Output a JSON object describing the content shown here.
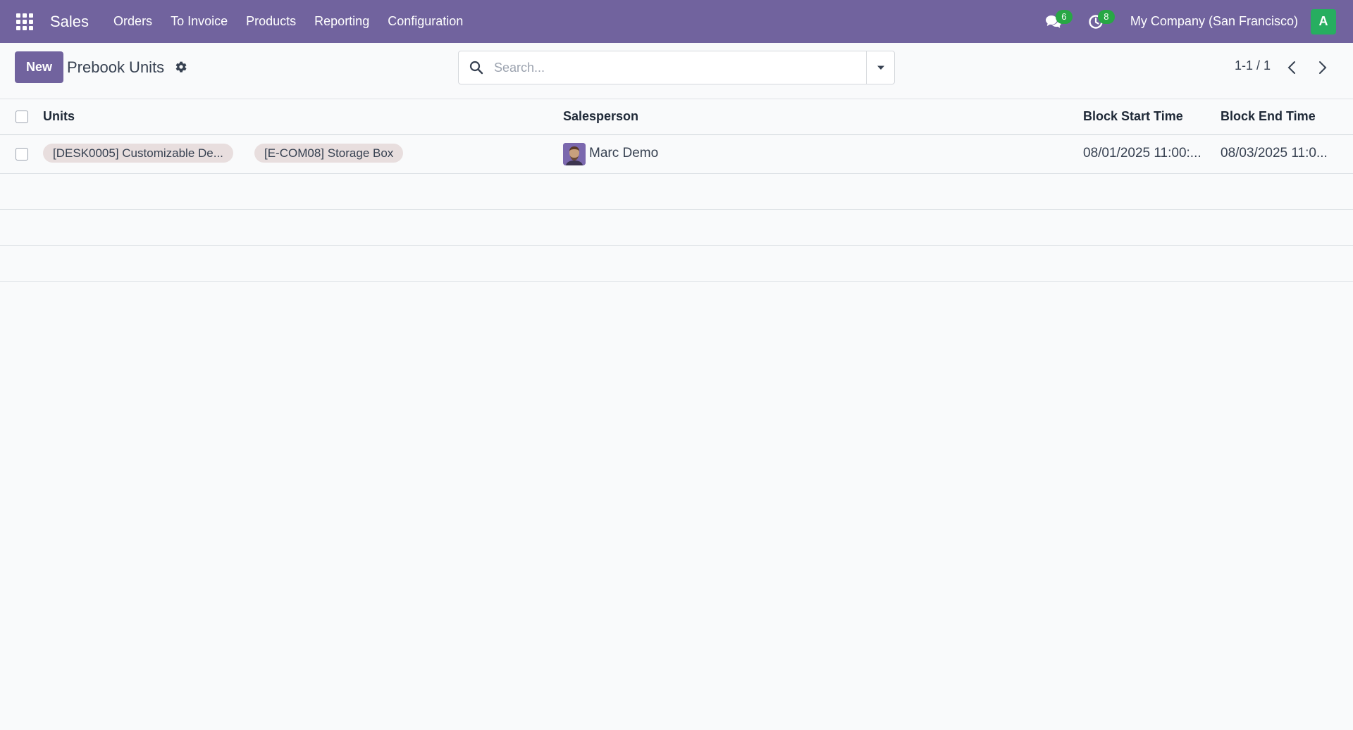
{
  "navbar": {
    "app_name": "Sales",
    "menu": [
      "Orders",
      "To Invoice",
      "Products",
      "Reporting",
      "Configuration"
    ],
    "messages_count": "6",
    "activities_count": "8",
    "company": "My Company (San Francisco)",
    "user_initial": "A",
    "bg_color": "#71639e"
  },
  "control_panel": {
    "new_label": "New",
    "title": "Prebook Units",
    "search_placeholder": "Search...",
    "pager": "1-1 / 1"
  },
  "list": {
    "columns": [
      "Units",
      "Salesperson",
      "Block Start Time",
      "Block End Time"
    ],
    "rows": [
      {
        "units": [
          "[DESK0005] Customizable De...",
          "[E-COM08] Storage Box"
        ],
        "salesperson": "Marc Demo",
        "block_start": "08/01/2025 11:00:...",
        "block_end": "08/03/2025 11:0..."
      }
    ]
  }
}
